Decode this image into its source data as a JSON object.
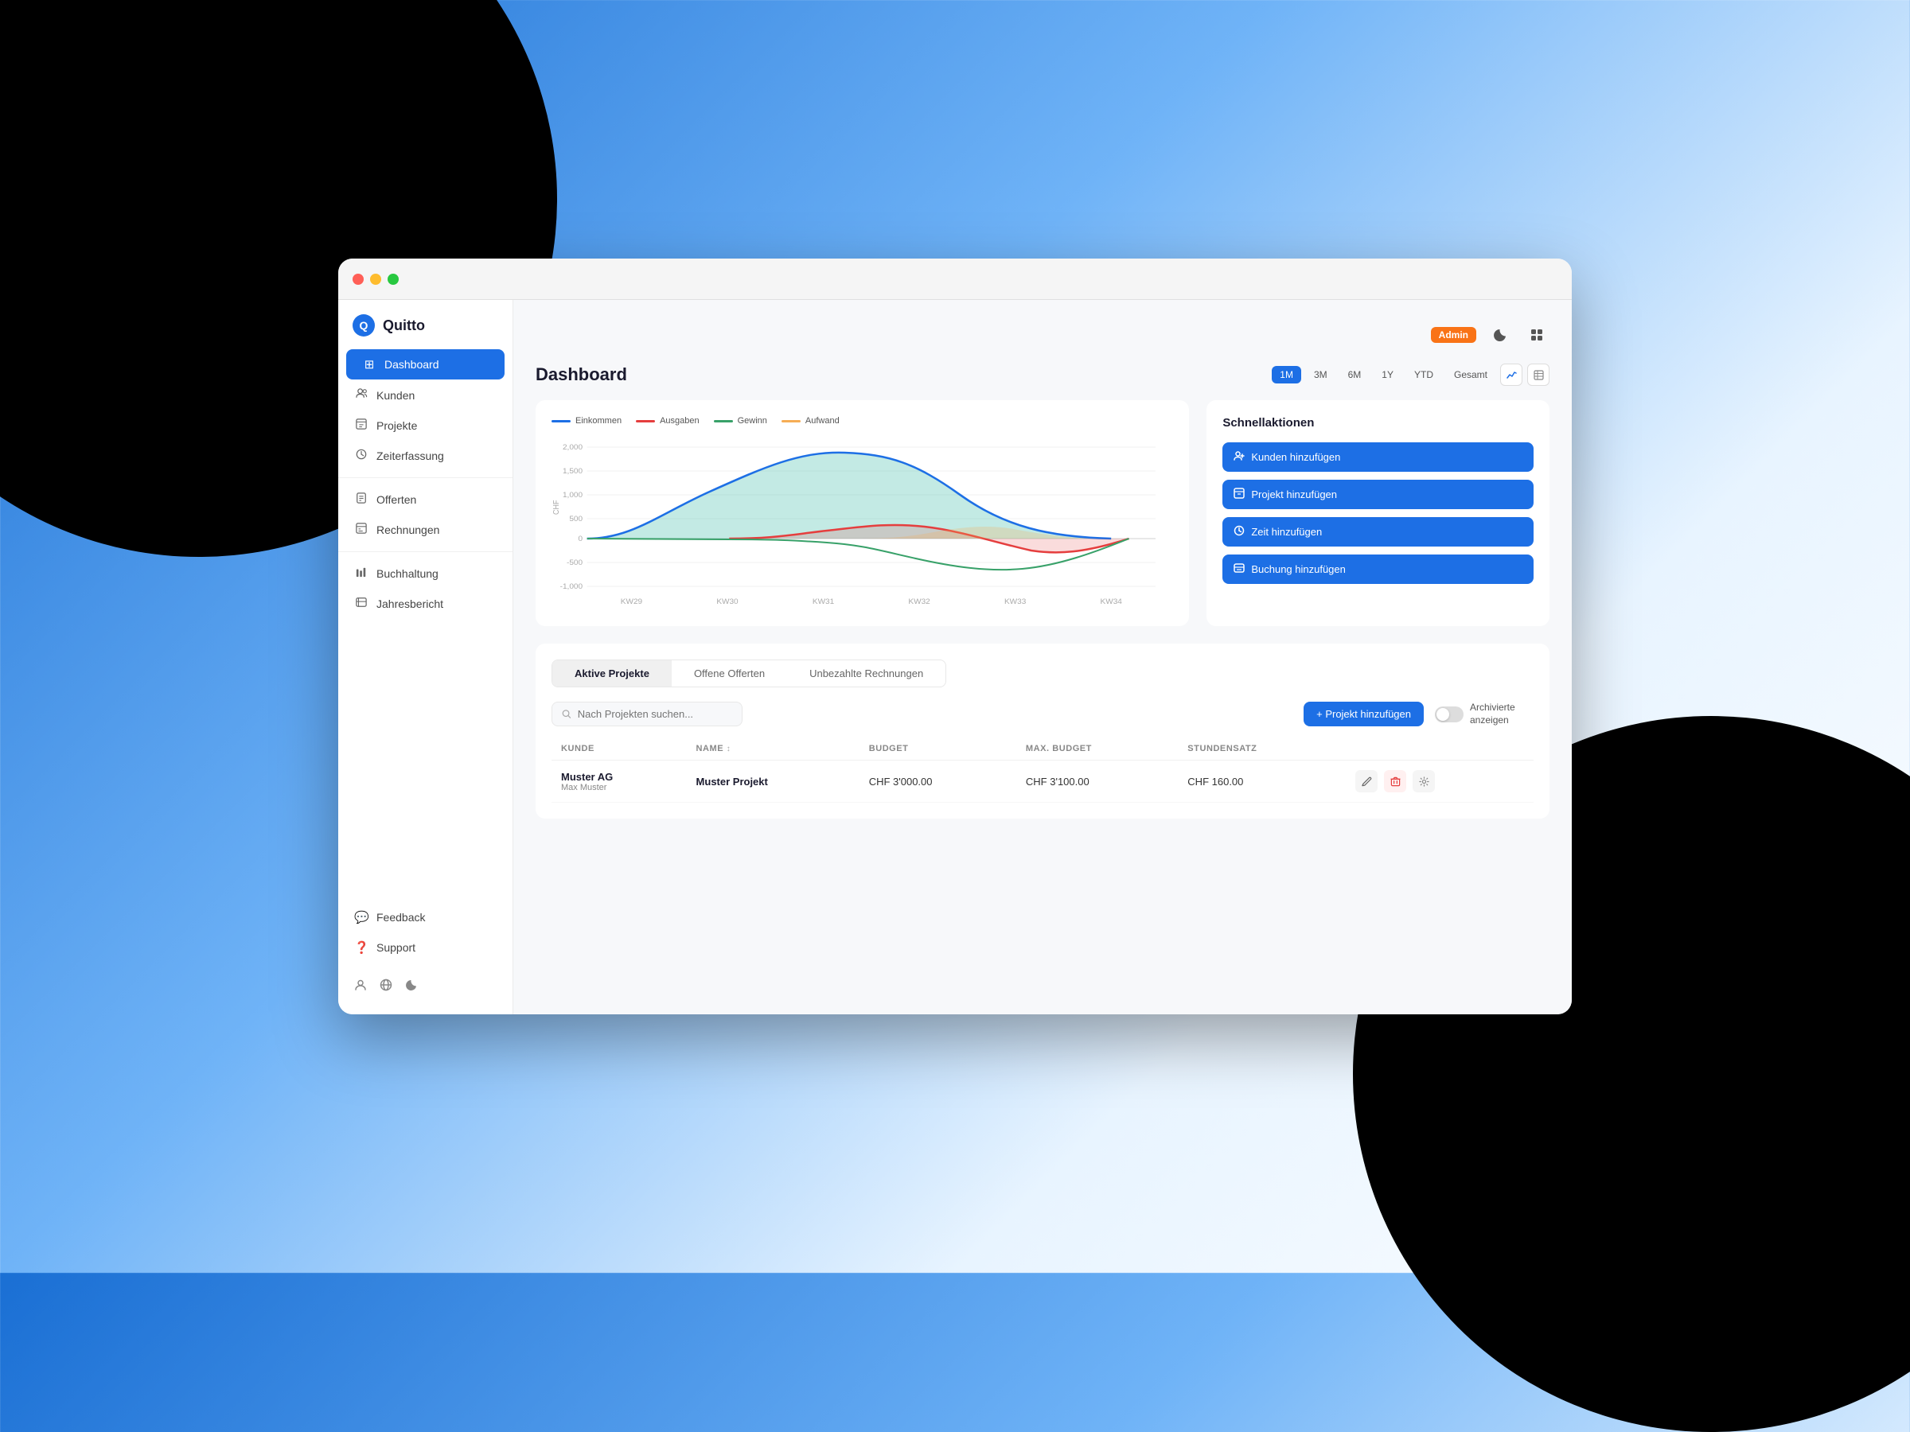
{
  "app": {
    "title": "Quitto",
    "logo_symbol": "Q",
    "admin_badge": "Admin"
  },
  "titlebar": {
    "traffic_lights": [
      "red",
      "yellow",
      "green"
    ]
  },
  "topbar": {
    "icons": {
      "dark_mode": "🌙",
      "layout": "⊞"
    }
  },
  "sidebar": {
    "items": [
      {
        "id": "dashboard",
        "label": "Dashboard",
        "icon": "⊞",
        "active": true
      },
      {
        "id": "kunden",
        "label": "Kunden",
        "icon": "👥",
        "active": false
      },
      {
        "id": "projekte",
        "label": "Projekte",
        "icon": "📋",
        "active": false
      },
      {
        "id": "zeiterfassung",
        "label": "Zeiterfassung",
        "icon": "⏱",
        "active": false
      },
      {
        "id": "offerten",
        "label": "Offerten",
        "icon": "📄",
        "active": false
      },
      {
        "id": "rechnungen",
        "label": "Rechnungen",
        "icon": "🧾",
        "active": false
      },
      {
        "id": "buchhaltung",
        "label": "Buchhaltung",
        "icon": "📊",
        "active": false
      },
      {
        "id": "jahresbericht",
        "label": "Jahresbericht",
        "icon": "📅",
        "active": false
      }
    ],
    "bottom_items": [
      {
        "id": "feedback",
        "label": "Feedback",
        "icon": "💬"
      },
      {
        "id": "support",
        "label": "Support",
        "icon": "❓"
      }
    ],
    "bottom_icons": [
      {
        "id": "profile",
        "icon": "👤"
      },
      {
        "id": "language",
        "icon": "🌐"
      },
      {
        "id": "dark-mode",
        "icon": "🌙"
      }
    ]
  },
  "dashboard": {
    "title": "Dashboard",
    "time_filters": [
      {
        "label": "1M",
        "active": true
      },
      {
        "label": "3M",
        "active": false
      },
      {
        "label": "6M",
        "active": false
      },
      {
        "label": "1Y",
        "active": false
      },
      {
        "label": "YTD",
        "active": false
      },
      {
        "label": "Gesamt",
        "active": false
      }
    ],
    "chart": {
      "legend": [
        {
          "label": "Einkommen",
          "color": "#1d6fe5"
        },
        {
          "label": "Ausgaben",
          "color": "#e53e3e"
        },
        {
          "label": "Gewinn",
          "color": "#38a169"
        },
        {
          "label": "Aufwand",
          "color": "#f6ad55"
        }
      ],
      "x_labels": [
        "KW29",
        "KW30",
        "KW31",
        "KW32",
        "KW33",
        "KW34"
      ],
      "y_labels": [
        "2,000",
        "1,500",
        "1,000",
        "500",
        "0",
        "-500",
        "-1,000"
      ],
      "y_unit": "CHF"
    },
    "quick_actions": {
      "title": "Schnellaktionen",
      "buttons": [
        {
          "label": "Kunden hinzufügen",
          "icon": "👤"
        },
        {
          "label": "Projekt hinzufügen",
          "icon": "📋"
        },
        {
          "label": "Zeit hinzufügen",
          "icon": "⏱"
        },
        {
          "label": "Buchung hinzufügen",
          "icon": "📖"
        }
      ]
    },
    "tabs": [
      {
        "label": "Aktive Projekte",
        "active": true
      },
      {
        "label": "Offene Offerten",
        "active": false
      },
      {
        "label": "Unbezahlte Rechnungen",
        "active": false
      }
    ],
    "search_placeholder": "Nach Projekten suchen...",
    "add_project_btn": "+ Projekt hinzufügen",
    "archive_label": "Archivierte anzeigen",
    "table": {
      "columns": [
        {
          "label": "KUNDE",
          "sortable": false
        },
        {
          "label": "NAME",
          "sortable": true
        },
        {
          "label": "BUDGET",
          "sortable": false
        },
        {
          "label": "MAX. BUDGET",
          "sortable": false
        },
        {
          "label": "STUNDENSATZ",
          "sortable": false
        },
        {
          "label": "",
          "sortable": false
        }
      ],
      "rows": [
        {
          "client_name": "Muster AG",
          "client_sub": "Max Muster",
          "project_name": "Muster Projekt",
          "budget": "CHF 3'000.00",
          "max_budget": "CHF 3'100.00",
          "stundensatz": "CHF 160.00"
        }
      ]
    }
  },
  "colors": {
    "primary": "#1d6fe5",
    "income": "#1d6fe5",
    "expense": "#e53e3e",
    "profit": "#38a169",
    "effort": "#f6ad55",
    "bg": "#f7f8fa",
    "sidebar_active": "#1d6fe5"
  }
}
